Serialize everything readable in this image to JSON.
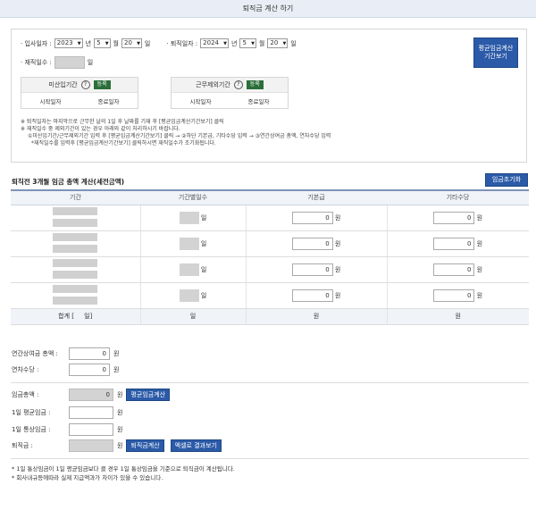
{
  "header": {
    "title": "퇴직금 계산 하기"
  },
  "dates": {
    "entry_label": "· 입사일자 :",
    "entry_year": "2023",
    "entry_month": "5",
    "entry_day": "20",
    "exit_label": "· 퇴직일자 :",
    "exit_year": "2024",
    "exit_month": "5",
    "exit_day": "20",
    "year_unit": "년",
    "month_unit": "월",
    "day_unit": "일"
  },
  "service_days": {
    "label": "· 재직일수 :",
    "unit": "일"
  },
  "avg_wage_period_button": "평균임금계산\n기간보기",
  "probation": {
    "title": "미산입기간",
    "help": "?",
    "register": "등록",
    "start": "시작일자",
    "end": "종료일자"
  },
  "excluded": {
    "title": "근무제외기간",
    "help": "?",
    "register": "등록",
    "start": "시작일자",
    "end": "종료일자"
  },
  "notes": [
    "※ 퇴직일자는 마지막으로 근무한 날의 1일 후 날짜를 기재 후 [평균임금계산기간보기] 클릭",
    "※ 재직일수 중 제외기간이 있는 경우 아래와 같이 처리하시기 바랍니다.",
    "①미산입기간/근무제외기간 입력 후 [평균임금계산기간보기] 클릭 → ②하단 기본급, 기타수당 입력 → ③연간상여금 총액, 연차수당 입력",
    "*재직일수를 입력후 [평균임금계산기간보기] 클릭하시면 재직일수가 조기화됩니다."
  ],
  "section": {
    "title": "퇴직전 3개월 임금 총액 계산(세전금액)",
    "reset_button": "임금초기화"
  },
  "table": {
    "headers": [
      "기간",
      "기간별일수",
      "기본급",
      "기타수당"
    ],
    "rows": [
      {
        "day_unit": "일",
        "base": "0",
        "other": "0",
        "won": "원"
      },
      {
        "day_unit": "일",
        "base": "0",
        "other": "0",
        "won": "원"
      },
      {
        "day_unit": "일",
        "base": "0",
        "other": "0",
        "won": "원"
      },
      {
        "day_unit": "일",
        "base": "0",
        "other": "0",
        "won": "원"
      }
    ],
    "total": {
      "label": "합계 [",
      "label_end": "일]",
      "days": "일",
      "base": "원",
      "other": "원"
    }
  },
  "bonus": {
    "label": "연간상여금 총액 :",
    "value": "0",
    "unit": "원"
  },
  "annual_leave": {
    "label": "연차수당 :",
    "value": "0",
    "unit": "원"
  },
  "wage_total": {
    "label": "임금총액 :",
    "value": "0",
    "unit": "원",
    "button": "평균임금계산"
  },
  "daily_avg": {
    "label": "1일 평균임금 :",
    "unit": "원"
  },
  "daily_ordinary": {
    "label": "1일 통상임금 :",
    "unit": "원"
  },
  "severance": {
    "label": "퇴직금 :",
    "unit": "원",
    "calc_button": "퇴직금계산",
    "excel_button": "엑셀로 결과보기"
  },
  "footnotes": [
    "* 1일 통상임금이 1일 평균임금보다 클 경우 1일 통상임금을 기준으로 퇴직금이 계산됩니다.",
    "* 회사내규등에따라 실제 지급액과가 차이가 있을 수 있습니다."
  ]
}
